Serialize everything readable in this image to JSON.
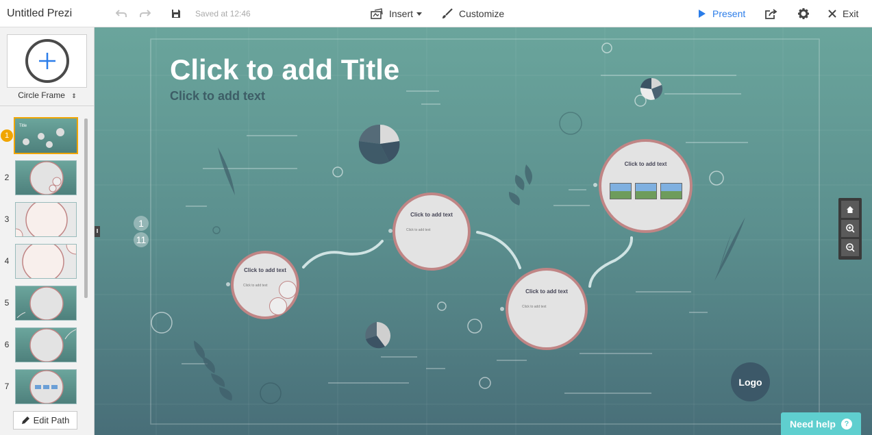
{
  "app": {
    "title": "Untitled Prezi",
    "saved_status": "Saved at 12:46"
  },
  "toolbar": {
    "insert_label": "Insert",
    "customize_label": "Customize",
    "present_label": "Present",
    "exit_label": "Exit",
    "accent_color": "#2b7de9"
  },
  "sidebar": {
    "frame_type": "Circle Frame",
    "edit_path_label": "Edit Path",
    "thumbnails": [
      {
        "number": "1",
        "selected": true
      },
      {
        "number": "2"
      },
      {
        "number": "3"
      },
      {
        "number": "4"
      },
      {
        "number": "5"
      },
      {
        "number": "6"
      },
      {
        "number": "7"
      }
    ]
  },
  "canvas": {
    "title": "Click to add Title",
    "subtitle": "Click to add text",
    "path_start": "1",
    "path_end": "11",
    "logo_label": "Logo",
    "help_label": "Need help",
    "help_icon": "?",
    "circles": [
      {
        "heading": "Click to add text",
        "body": "Click to add text"
      },
      {
        "heading": "Click to add text",
        "body": "Click to add text"
      },
      {
        "heading": "Click to add text",
        "body": "Click to add text"
      },
      {
        "heading": "Click to add text"
      }
    ]
  }
}
